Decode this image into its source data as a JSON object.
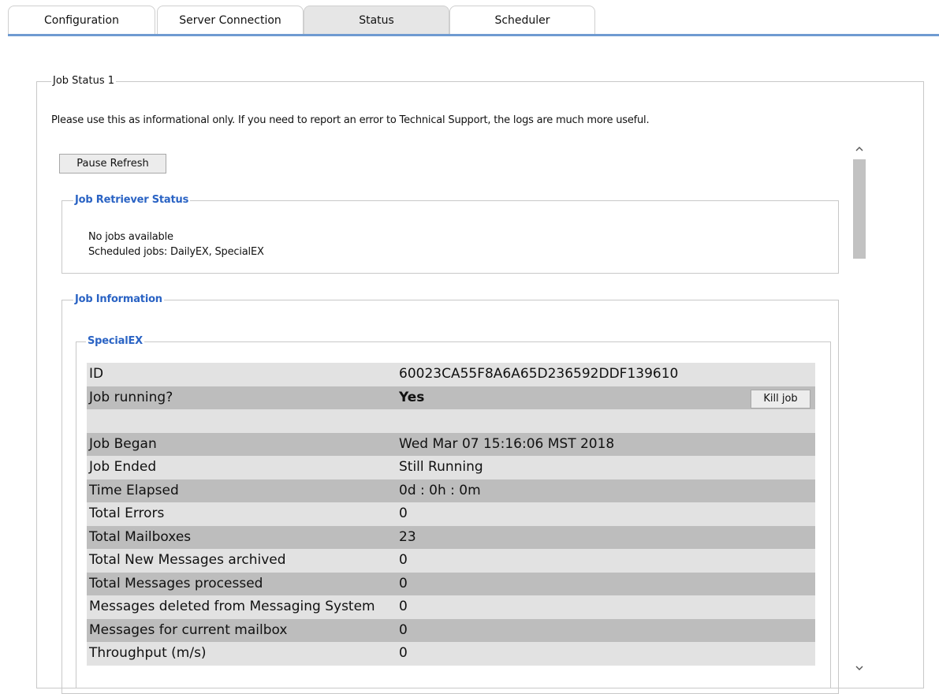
{
  "tabs": [
    {
      "label": "Configuration"
    },
    {
      "label": "Server Connection"
    },
    {
      "label": "Status",
      "active": true
    },
    {
      "label": "Scheduler"
    }
  ],
  "job_status": {
    "legend": "Job Status 1",
    "info": "Please use this as informational only. If you need to report an error to Technical Support, the logs are much more useful.",
    "pause_label": "Pause Refresh"
  },
  "retriever": {
    "legend": "Job Retriever Status",
    "line1": "No jobs available",
    "line2": "Scheduled jobs: DailyEX, SpecialEX"
  },
  "job_info": {
    "legend": "Job Information",
    "job": {
      "legend": "SpecialEX",
      "kill_label": "Kill job",
      "rows": [
        {
          "key": "ID",
          "value": "60023CA55F8A6A65D236592DDF139610"
        },
        {
          "key": "Job running?",
          "value": "Yes"
        },
        {
          "key": "",
          "value": ""
        },
        {
          "key": "Job Began",
          "value": "Wed Mar 07 15:16:06 MST 2018"
        },
        {
          "key": "Job Ended",
          "value": "Still Running"
        },
        {
          "key": "Time Elapsed",
          "value": "0d : 0h : 0m"
        },
        {
          "key": "Total Errors",
          "value": "0"
        },
        {
          "key": "Total Mailboxes",
          "value": "23"
        },
        {
          "key": "Total New Messages archived",
          "value": "0"
        },
        {
          "key": "Total Messages processed",
          "value": "0"
        },
        {
          "key": "Messages deleted from Messaging System",
          "value": "0"
        },
        {
          "key": "Messages for current mailbox",
          "value": "0"
        },
        {
          "key": "Throughput (m/s)",
          "value": "0"
        }
      ]
    }
  },
  "scrollbar": {
    "up_icon": "chevron-up-icon",
    "down_icon": "chevron-down-icon"
  }
}
